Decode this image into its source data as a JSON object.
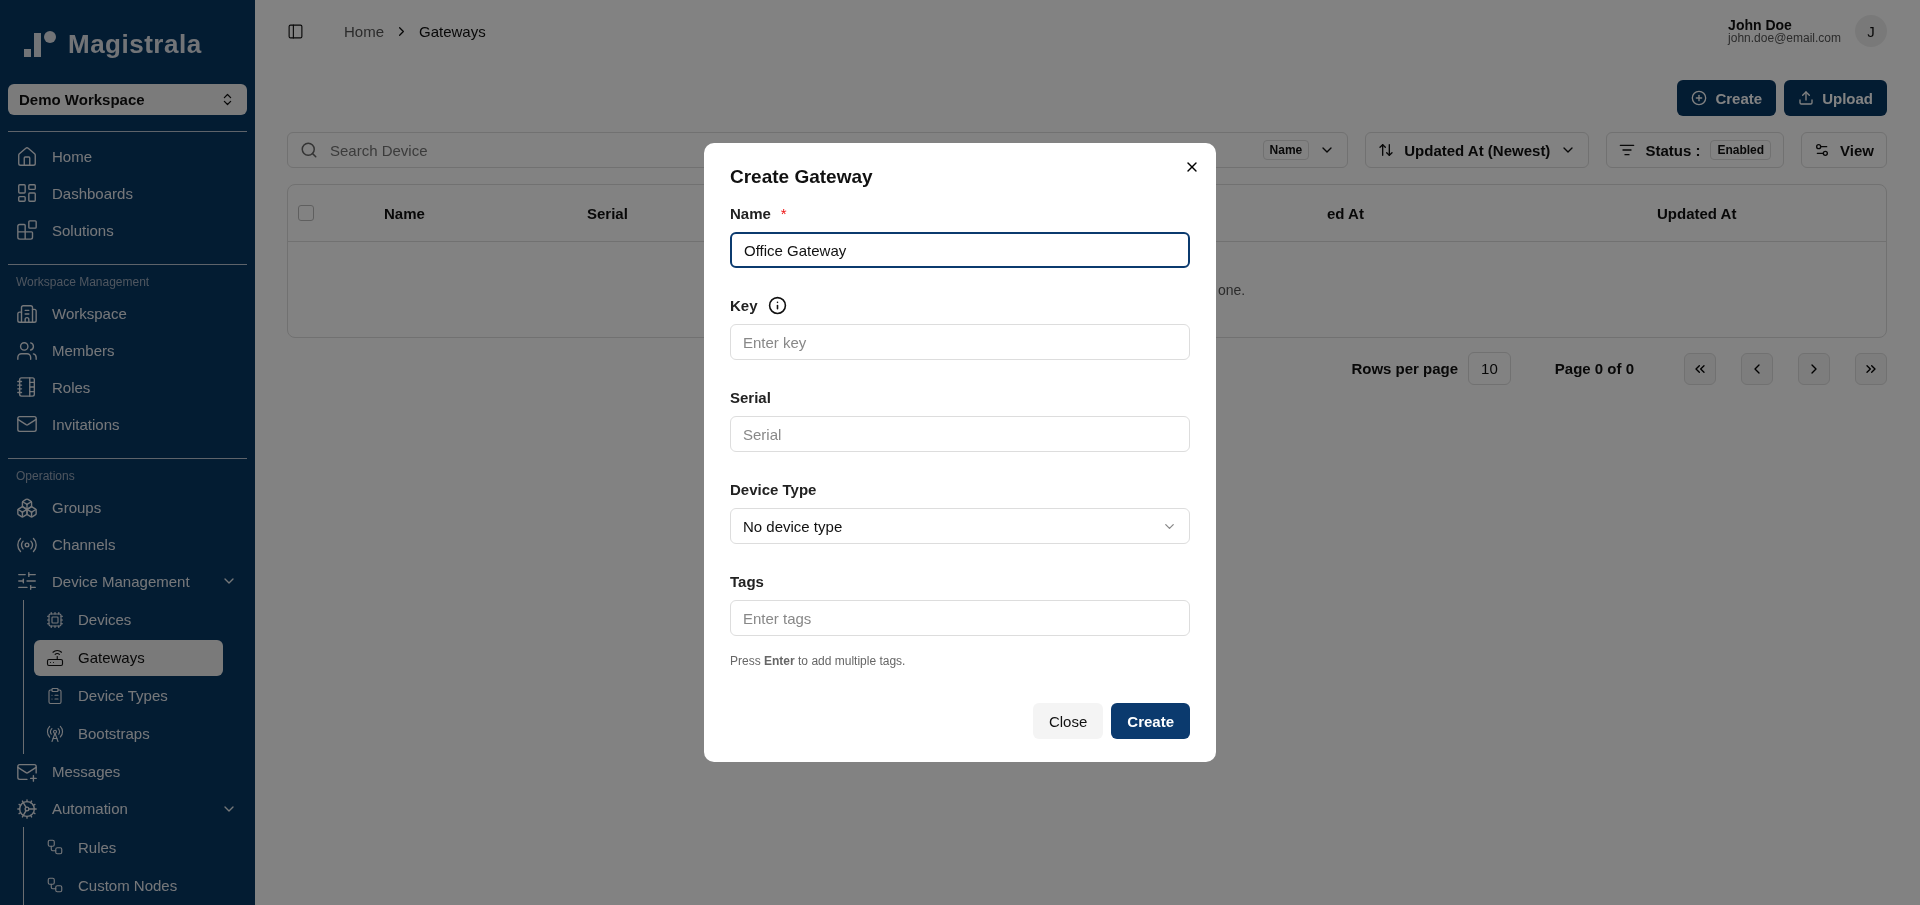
{
  "brand": {
    "name": "Magistrala"
  },
  "workspace_select": {
    "value": "Demo Workspace"
  },
  "sidebar": {
    "sections": [
      {
        "items": [
          {
            "label": "Home",
            "selected": false
          },
          {
            "label": "Dashboards",
            "selected": false
          },
          {
            "label": "Solutions",
            "selected": false
          }
        ]
      },
      {
        "heading": "Workspace Management",
        "items": [
          {
            "label": "Workspace",
            "selected": false
          },
          {
            "label": "Members",
            "selected": false
          },
          {
            "label": "Roles",
            "selected": false
          },
          {
            "label": "Invitations",
            "selected": false
          }
        ]
      },
      {
        "heading": "Operations",
        "items": [
          {
            "label": "Groups",
            "selected": false
          },
          {
            "label": "Channels",
            "selected": false
          },
          {
            "label": "Device Management",
            "selected": false,
            "expanded": true,
            "children": [
              {
                "label": "Devices",
                "selected": false
              },
              {
                "label": "Gateways",
                "selected": true
              },
              {
                "label": "Device Types",
                "selected": false
              },
              {
                "label": "Bootstraps",
                "selected": false
              }
            ]
          },
          {
            "label": "Messages",
            "selected": false
          },
          {
            "label": "Automation",
            "selected": false,
            "expanded": true,
            "children": [
              {
                "label": "Rules",
                "selected": false
              },
              {
                "label": "Custom Nodes",
                "selected": false
              }
            ]
          }
        ]
      }
    ]
  },
  "breadcrumb": [
    "Home",
    "Gateways"
  ],
  "user": {
    "name": "John Doe",
    "email": "john.doe@email.com",
    "initial": "J"
  },
  "actions": [
    "Create",
    "Upload"
  ],
  "toolbar": {
    "search_placeholder": "Search Device",
    "search_by": "Name",
    "sort": "Updated At (Newest)",
    "status_label": "Status :",
    "status_value": "Enabled",
    "view": "View"
  },
  "table": {
    "checked": false,
    "columns": [
      "Name",
      "Serial",
      "ed At",
      "Updated At"
    ],
    "empty_message": "one."
  },
  "pagination": {
    "rows_label": "Rows per page",
    "rows_value": "10",
    "page": "Page 0 of 0"
  },
  "dialog": {
    "title": "Create Gateway",
    "fields": [
      {
        "kind": "text",
        "label": "Name",
        "required_mark": "*",
        "value": "Office Gateway",
        "focused": true
      },
      {
        "kind": "text",
        "label": "Key",
        "info": true,
        "placeholder": "Enter key",
        "focused": false
      },
      {
        "kind": "text",
        "label": "Serial",
        "placeholder": "Serial",
        "focused": false
      },
      {
        "kind": "select",
        "label": "Device Type",
        "value": "No device type"
      },
      {
        "kind": "text",
        "label": "Tags",
        "placeholder": "Enter tags",
        "focused": false,
        "hint": "Press **Enter** to add multiple tags."
      }
    ],
    "buttons": [
      {
        "label": "Close",
        "kind": "secondary"
      },
      {
        "label": "Create",
        "kind": "primary"
      }
    ]
  }
}
